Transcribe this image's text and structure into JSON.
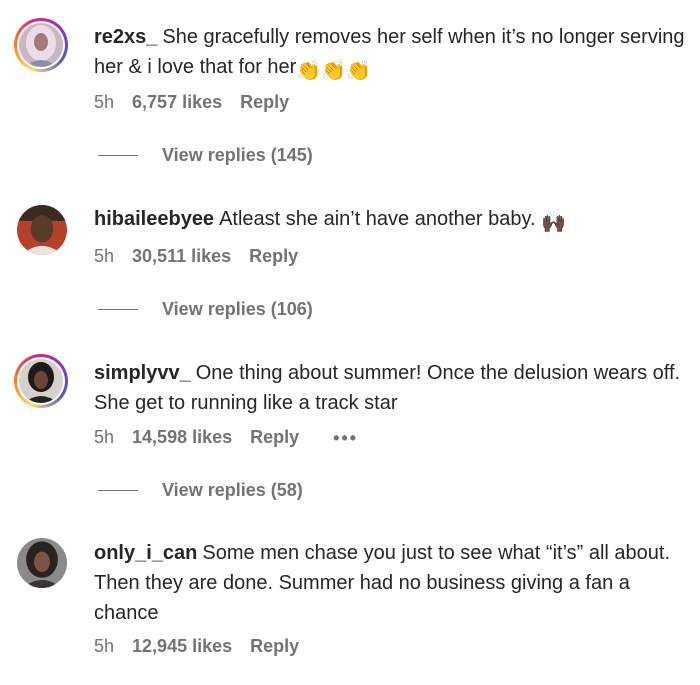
{
  "comments": [
    {
      "username": "re2xs_",
      "text": "She gracefully removes her self when it’s no longer serving her & i love that for her",
      "emoji": "👏👏👏",
      "time": "5h",
      "likes": "6,757 likes",
      "reply": "Reply",
      "view_replies": "View replies (145)"
    },
    {
      "username": "hibaileebyee",
      "text": "Atleast she ain’t have another baby.",
      "emoji": "🙌🏿",
      "time": "5h",
      "likes": "30,511 likes",
      "reply": "Reply",
      "view_replies": "View replies (106)"
    },
    {
      "username": "simplyvv_",
      "text": "One thing about summer! Once the delusion wears off. She get to running like a track star",
      "emoji": "",
      "time": "5h",
      "likes": "14,598 likes",
      "reply": "Reply",
      "more": "•••",
      "view_replies": "View replies (58)"
    },
    {
      "username": "only_i_can",
      "text": "Some men chase you just to see what “it’s” all about. Then they are done. Summer had no business giving a fan a chance",
      "emoji": "",
      "time": "5h",
      "likes": "12,945 likes",
      "reply": "Reply"
    }
  ],
  "colors": {
    "text": "#262626",
    "meta": "#737373",
    "story_ring": [
      "#feda75",
      "#fa7e1e",
      "#d62976",
      "#962fbf",
      "#4f5bd5"
    ]
  }
}
